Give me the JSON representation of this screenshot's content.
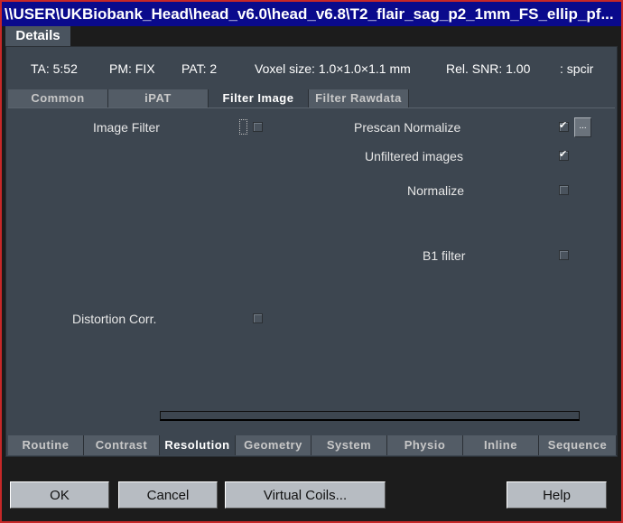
{
  "window": {
    "title": "\\\\USER\\UKBiobank_Head\\head_v6.0\\head_v6.8\\T2_flair_sag_p2_1mm_FS_ellip_pf..."
  },
  "top_tab": {
    "label": "Details"
  },
  "info_bar": {
    "ta": "TA: 5:52",
    "pm": "PM: FIX",
    "pat": "PAT: 2",
    "voxel": "Voxel size: 1.0×1.0×1.1 mm",
    "snr": "Rel. SNR: 1.00",
    "seq": ": spcir"
  },
  "subtabs": [
    "Common",
    "iPAT",
    "Filter Image",
    "Filter Rawdata"
  ],
  "params": {
    "image_filter": "Image Filter",
    "distortion_corr": "Distortion Corr.",
    "prescan_normalize": "Prescan Normalize",
    "unfiltered_images": "Unfiltered images",
    "normalize": "Normalize",
    "b1_filter": "B1 filter",
    "ellipsis": "..."
  },
  "bottom_tabs": [
    "Routine",
    "Contrast",
    "Resolution",
    "Geometry",
    "System",
    "Physio",
    "Inline",
    "Sequence"
  ],
  "buttons": {
    "ok": "OK",
    "cancel": "Cancel",
    "virtual_coils": "Virtual Coils...",
    "help": "Help"
  }
}
